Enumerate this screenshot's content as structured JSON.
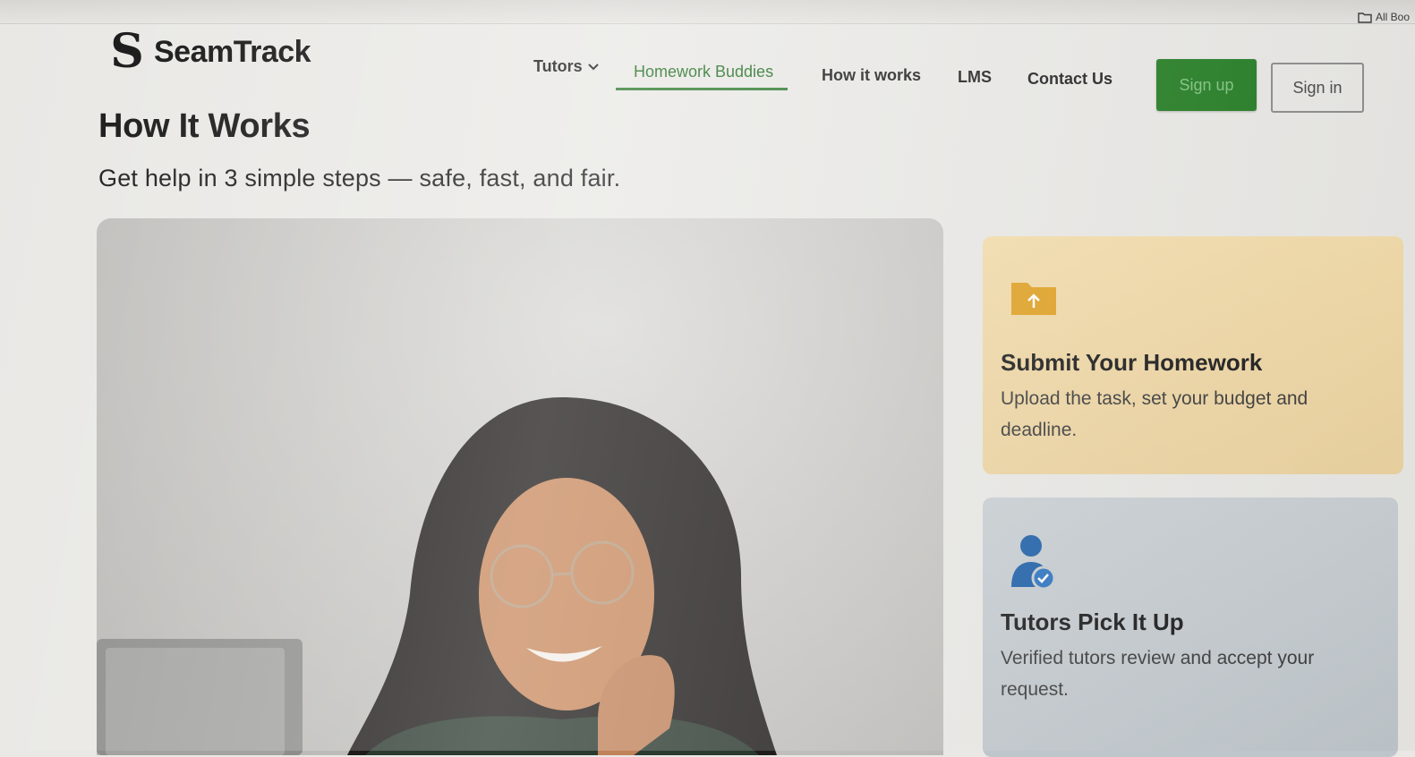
{
  "browser": {
    "bookmarks_label": "All Boo"
  },
  "header": {
    "logo_mark": "S",
    "logo_text": "SeamTrack",
    "nav": [
      {
        "label": "Tutors",
        "has_dropdown": true
      },
      {
        "label": "Homework Buddies",
        "active": true
      },
      {
        "label": "How it works"
      },
      {
        "label": "LMS"
      },
      {
        "label": "Contact Us"
      }
    ],
    "signup_label": "Sign up",
    "signin_label": "Sign in"
  },
  "main": {
    "title": "How It Works",
    "subtitle": "Get help in 3 simple steps — safe, fast, and fair.",
    "steps": [
      {
        "title": "Submit Your Homework",
        "description": "Upload the task, set your budget and deadline.",
        "icon": "folder-upload-icon"
      },
      {
        "title": "Tutors Pick It Up",
        "description": "Verified tutors review and accept your request.",
        "icon": "verified-tutor-icon"
      }
    ]
  },
  "colors": {
    "brand_green": "#1f7a1f",
    "card_step1": "#f0d8a6",
    "card_step2": "#c5cbcf",
    "folder_icon": "#e0a020",
    "tutor_icon": "#1d5fa8"
  }
}
